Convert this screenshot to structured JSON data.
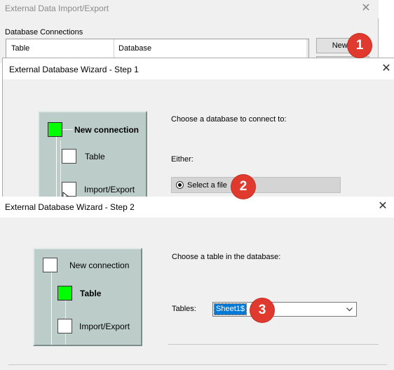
{
  "window_import_export": {
    "title": "External Data Import/Export",
    "close_glyph": "✕",
    "group_label": "Database Connections",
    "columns": [
      "Table",
      "Database"
    ],
    "new_button_label": "New..."
  },
  "wizard_step1": {
    "title": "External Database Wizard - Step 1",
    "close_glyph": "✕",
    "steps": [
      {
        "label": "New connection",
        "active": true
      },
      {
        "label": "Table",
        "active": false
      },
      {
        "label": "Import/Export",
        "active": false
      }
    ],
    "prompt": "Choose a database to connect to:",
    "either_label": "Either:",
    "radio_option": {
      "label": "Select a file",
      "selected": true
    }
  },
  "wizard_step2": {
    "title": "External Database Wizard - Step 2",
    "close_glyph": "✕",
    "steps": [
      {
        "label": "New connection",
        "active": false
      },
      {
        "label": "Table",
        "active": true
      },
      {
        "label": "Import/Export",
        "active": false
      }
    ],
    "prompt": "Choose a table in the database:",
    "tables_label": "Tables:",
    "tables_value": "Sheet1$"
  },
  "callouts": [
    "1",
    "2",
    "3"
  ],
  "colors": {
    "callout": "#e03a2f",
    "active_step": "#00ff00",
    "steps_panel": "#bccdc9",
    "selection": "#0078d7"
  }
}
